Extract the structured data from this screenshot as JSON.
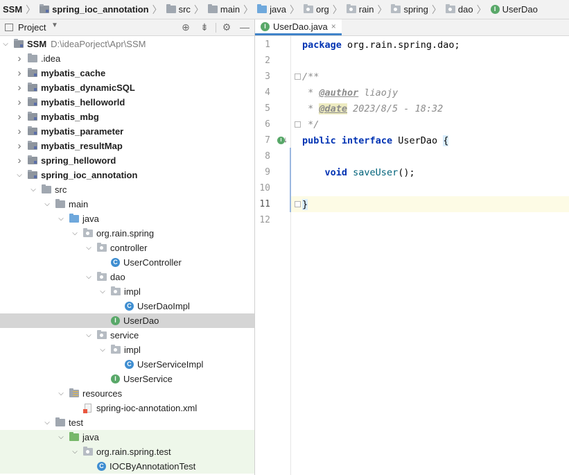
{
  "breadcrumb": [
    {
      "label": "SSM",
      "icon": "module-folder-icon",
      "bold": true
    },
    {
      "label": "spring_ioc_annotation",
      "icon": "module-folder-icon",
      "bold": true
    },
    {
      "label": "src",
      "icon": "folder-icon",
      "bold": false
    },
    {
      "label": "main",
      "icon": "folder-icon",
      "bold": false
    },
    {
      "label": "java",
      "icon": "source-folder-icon",
      "bold": false
    },
    {
      "label": "org",
      "icon": "package-icon",
      "bold": false
    },
    {
      "label": "rain",
      "icon": "package-icon",
      "bold": false
    },
    {
      "label": "spring",
      "icon": "package-icon",
      "bold": false
    },
    {
      "label": "dao",
      "icon": "package-icon",
      "bold": false
    },
    {
      "label": "UserDao",
      "icon": "interface-icon",
      "bold": false
    }
  ],
  "project_panel": {
    "title": "Project",
    "tools": [
      "locate-icon",
      "collapse-all-icon",
      "settings-icon",
      "hide-icon"
    ]
  },
  "tree": [
    {
      "d": 0,
      "exp": true,
      "icon": "mod",
      "label": "SSM",
      "bold": true,
      "path": "D:\\ideaPorject\\Apr\\SSM"
    },
    {
      "d": 1,
      "exp": false,
      "icon": "folder",
      "label": ".idea"
    },
    {
      "d": 1,
      "exp": false,
      "icon": "mod",
      "label": "mybatis_cache",
      "bold": true
    },
    {
      "d": 1,
      "exp": false,
      "icon": "mod",
      "label": "mybatis_dynamicSQL",
      "bold": true
    },
    {
      "d": 1,
      "exp": false,
      "icon": "mod",
      "label": "mybatis_helloworld",
      "bold": true
    },
    {
      "d": 1,
      "exp": false,
      "icon": "mod",
      "label": "mybatis_mbg",
      "bold": true
    },
    {
      "d": 1,
      "exp": false,
      "icon": "mod",
      "label": "mybatis_parameter",
      "bold": true
    },
    {
      "d": 1,
      "exp": false,
      "icon": "mod",
      "label": "mybatis_resultMap",
      "bold": true
    },
    {
      "d": 1,
      "exp": false,
      "icon": "mod",
      "label": "spring_helloword",
      "bold": true
    },
    {
      "d": 1,
      "exp": true,
      "icon": "mod",
      "label": "spring_ioc_annotation",
      "bold": true
    },
    {
      "d": 2,
      "exp": true,
      "icon": "folder",
      "label": "src"
    },
    {
      "d": 3,
      "exp": true,
      "icon": "folder",
      "label": "main"
    },
    {
      "d": 4,
      "exp": true,
      "icon": "src",
      "label": "java"
    },
    {
      "d": 5,
      "exp": true,
      "icon": "pkg",
      "label": "org.rain.spring"
    },
    {
      "d": 6,
      "exp": true,
      "icon": "pkg",
      "label": "controller"
    },
    {
      "d": 7,
      "icon": "cls",
      "label": "UserController"
    },
    {
      "d": 6,
      "exp": true,
      "icon": "pkg",
      "label": "dao"
    },
    {
      "d": 7,
      "exp": true,
      "icon": "pkg",
      "label": "impl"
    },
    {
      "d": 8,
      "icon": "cls",
      "label": "UserDaoImpl"
    },
    {
      "d": 7,
      "icon": "itf",
      "label": "UserDao",
      "selected": true
    },
    {
      "d": 6,
      "exp": true,
      "icon": "pkg",
      "label": "service"
    },
    {
      "d": 7,
      "exp": true,
      "icon": "pkg",
      "label": "impl"
    },
    {
      "d": 8,
      "icon": "cls",
      "label": "UserServiceImpl"
    },
    {
      "d": 7,
      "icon": "itf",
      "label": "UserService"
    },
    {
      "d": 4,
      "exp": true,
      "icon": "res",
      "label": "resources"
    },
    {
      "d": 5,
      "icon": "xml",
      "label": "spring-ioc-annotation.xml"
    },
    {
      "d": 3,
      "exp": true,
      "icon": "folder",
      "label": "test"
    },
    {
      "d": 4,
      "exp": true,
      "icon": "tsrc",
      "label": "java",
      "test": true
    },
    {
      "d": 5,
      "exp": true,
      "icon": "pkg",
      "label": "org.rain.spring.test",
      "test": true
    },
    {
      "d": 6,
      "icon": "cls",
      "label": "IOCByAnnotationTest",
      "test": true
    }
  ],
  "editor": {
    "tab_label": "UserDao.java",
    "tab_close": "×",
    "line_numbers": [
      "1",
      "2",
      "3",
      "4",
      "5",
      "6",
      "7",
      "8",
      "9",
      "10",
      "11",
      "12"
    ],
    "current_line": "11",
    "code": {
      "l1_kw": "package",
      "l1_rest": " org.rain.spring.dao;",
      "l3": "/**",
      "l4_pre": " * ",
      "l4_tag": "@author",
      "l4_val": " liaojy",
      "l5_pre": " * ",
      "l5_tag": "@date",
      "l5_val": " 2023/8/5 - 18:32",
      "l6": " */",
      "l7_kw1": "public",
      "l7_kw2": "interface",
      "l7_name": " UserDao ",
      "l7_brace": "{",
      "l9_kw": "void",
      "l9_fn": "saveUser",
      "l9_rest": "();",
      "l11": "}"
    }
  }
}
